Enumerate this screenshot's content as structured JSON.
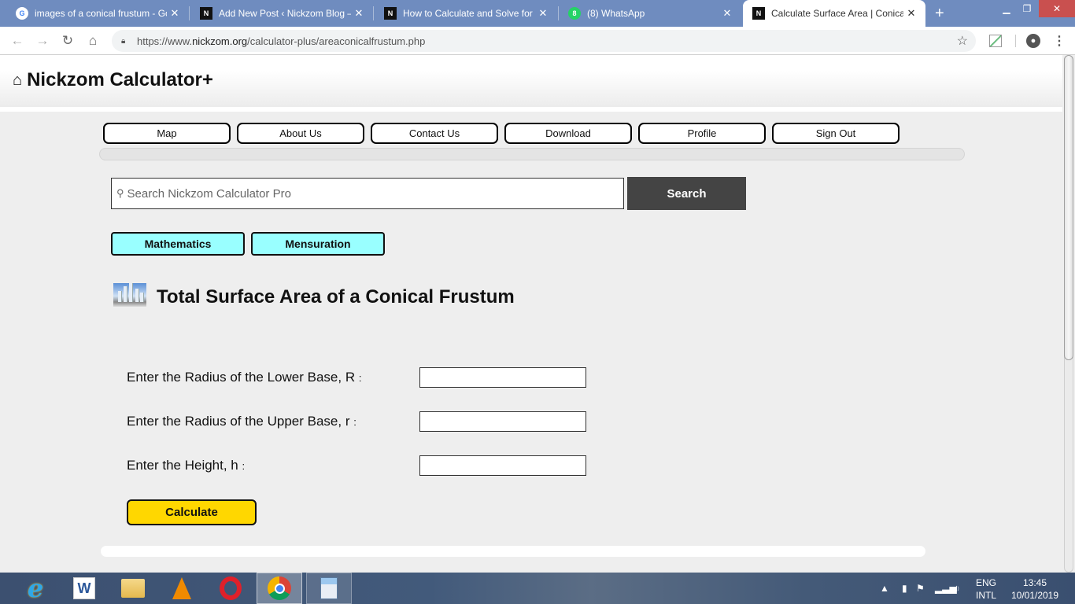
{
  "browser": {
    "tabs": [
      {
        "title": "images of a conical frustum - Go",
        "favicon": "google-g",
        "active": false
      },
      {
        "title": "Add New Post ‹ Nickzom Blog —",
        "favicon": "nickzom-logo",
        "active": false
      },
      {
        "title": "How to Calculate and Solve for t",
        "favicon": "nickzom-logo",
        "active": false
      },
      {
        "title": "(8) WhatsApp",
        "favicon": "whatsapp",
        "active": false
      },
      {
        "title": "Calculate Surface Area | Conical",
        "favicon": "nickzom-logo",
        "active": true
      }
    ],
    "url_prefix": "https://www.",
    "url_domain": "nickzom.org",
    "url_path": "/calculator-plus/areaconicalfrustum.php"
  },
  "site": {
    "title": "Nickzom Calculator+",
    "nav": [
      "Map",
      "About Us",
      "Contact Us",
      "Download",
      "Profile",
      "Sign Out"
    ],
    "search": {
      "placeholder": "Search Nickzom Calculator Pro",
      "value": "",
      "button": "Search"
    },
    "categories": [
      "Mathematics",
      "Mensuration"
    ]
  },
  "calculator": {
    "title": "Total Surface Area of a Conical Frustum",
    "fields": [
      {
        "label": "Enter the Radius of the Lower Base, R",
        "value": ""
      },
      {
        "label": "Enter the Radius of the Upper Base, r",
        "value": ""
      },
      {
        "label": "Enter the Height, h",
        "value": ""
      }
    ],
    "colon": ":",
    "calculate_label": "Calculate"
  },
  "taskbar": {
    "apps": [
      "Internet Explorer",
      "Microsoft Word",
      "File Explorer",
      "VLC media player",
      "Opera",
      "Google Chrome",
      "Calculator"
    ],
    "lang_top": "ENG",
    "lang_bottom": "INTL",
    "time": "13:45",
    "date": "10/01/2019"
  }
}
